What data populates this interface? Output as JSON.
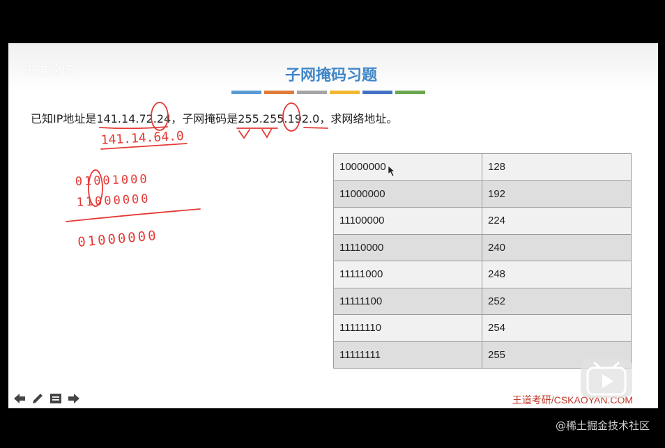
{
  "slide": {
    "logo": "王道论坛",
    "title": "子网掩码习题",
    "title_color": "#3f86c8",
    "color_bars": [
      "#5b9bd5",
      "#e07b39",
      "#a5a5a5",
      "#f2b830",
      "#4472c4",
      "#6aa84f"
    ],
    "question": {
      "prefix": "已知IP地址是",
      "ip": "141.14.72.24",
      "middle": "，子网掩码是",
      "mask": "255.255.192.0",
      "suffix": "，求网络地址。"
    },
    "handwriting": {
      "network_address": "141.14.64.0",
      "binary_ip_octet": "01001000",
      "binary_mask_octet": "11000000",
      "binary_result": "01000000"
    },
    "mask_table": [
      {
        "binary": "10000000",
        "decimal": "128"
      },
      {
        "binary": "11000000",
        "decimal": "192"
      },
      {
        "binary": "11100000",
        "decimal": "224"
      },
      {
        "binary": "11110000",
        "decimal": "240"
      },
      {
        "binary": "11111000",
        "decimal": "248"
      },
      {
        "binary": "11111100",
        "decimal": "252"
      },
      {
        "binary": "11111110",
        "decimal": "254"
      },
      {
        "binary": "11111111",
        "decimal": "255"
      }
    ],
    "footer_brand": "王道考研/CSKAOYAN.COM",
    "nav_icons": [
      "arrow-left-icon",
      "pencil-icon",
      "menu-icon",
      "arrow-right-icon"
    ]
  },
  "watermark": "@稀土掘金技术社区",
  "ink_color": "#e53935"
}
